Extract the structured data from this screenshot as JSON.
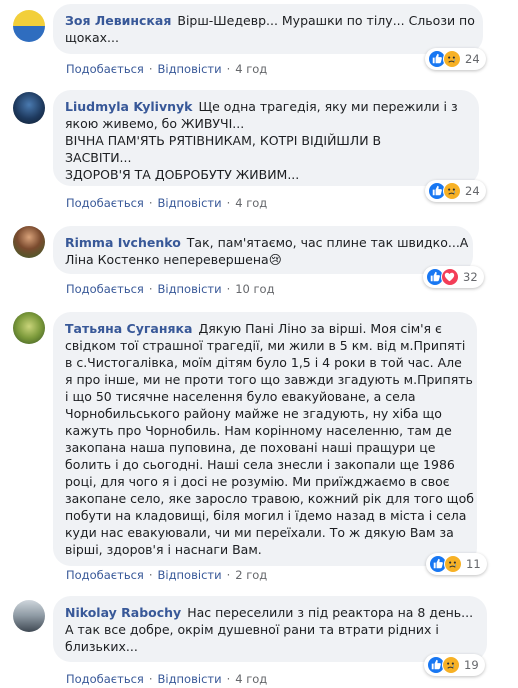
{
  "comments": [
    {
      "author": "Зоя Левинская",
      "lines": [
        "Вірш-Шедевр... Мурашки по тілу... Сльози по",
        "щоках..."
      ],
      "actions": {
        "like": "Подобається",
        "reply": "Відповісти",
        "time": "4 год"
      },
      "reactions": {
        "icons": [
          "like-icon",
          "sad-icon"
        ],
        "count": "24"
      }
    },
    {
      "author": "Liudmyla Kylivnyk",
      "lines": [
        "Ще одна трагедія, яку ми пережили і з",
        "якою живемо, бо ЖИВУЧІ...",
        "ВІЧНА ПАМ'ЯТЬ РЯТІВНИКАМ, КОТРІ ВІДІЙШЛИ В",
        "ЗАСВІТИ...",
        "ЗДОРОВ'Я ТА ДОБРОБУТУ ЖИВИМ..."
      ],
      "actions": {
        "like": "Подобається",
        "reply": "Відповісти",
        "time": "4 год"
      },
      "reactions": {
        "icons": [
          "like-icon",
          "sad-icon"
        ],
        "count": "24"
      }
    },
    {
      "author": "Rimma Ivchenko",
      "lines": [
        "Так, пам'ятаємо, час плине так швидко...А",
        "Ліна Костенко неперевершена😢"
      ],
      "actions": {
        "like": "Подобається",
        "reply": "Відповісти",
        "time": "10 год"
      },
      "reactions": {
        "icons": [
          "like-icon",
          "love-icon"
        ],
        "count": "32"
      }
    },
    {
      "author": "Татьяна Суганяка",
      "lines": [
        "Дякую Пані Ліно за вірші. Моя сім'я є",
        "свідком тої страшної трагедії, ми жили в 5 км. від м.Припяті",
        "в с.Чистогалівка, моїм дітям було 1,5 і 4 роки в той час. Але",
        "я про інше, ми не проти того що завжди згадують м.Припять",
        "і що 50 тисячне населення було евакуйоване, а села",
        "Чорнобильського району майже не згадують, ну хіба що",
        "кажуть про Чорнобиль. Нам корінному населенню, там де",
        "закопана наша пуповина, де поховані наші пращури це",
        "болить і до сьогодні. Наші села знесли і закопали ще 1986",
        "році, для чого я і досі не розумію. Ми приїжджаємо в своє",
        "закопане село, яке заросло травою, кожний рік для того щоб",
        "побути на кладовищі, біля могил і їдемо назад в міста і села",
        "куди нас евакуювали, чи ми переїхали. То ж дякую Вам за",
        "вірші, здоров'я і наснаги Вам."
      ],
      "actions": {
        "like": "Подобається",
        "reply": "Відповісти",
        "time": "2 год"
      },
      "reactions": {
        "icons": [
          "like-icon",
          "sad-icon"
        ],
        "count": "11"
      }
    },
    {
      "author": "Nikolay Rabochy",
      "lines": [
        "Нас переселили з під реактора на 8 день...",
        "А так все добре, окрім душевної рани та втрати рідних і",
        "близьких..."
      ],
      "actions": {
        "like": "Подобається",
        "reply": "Відповісти",
        "time": "4 год"
      },
      "reactions": {
        "icons": [
          "like-icon",
          "sad-icon"
        ],
        "count": "19"
      }
    }
  ],
  "colors": {
    "author": "#385898",
    "bubble": "#f0f2f5",
    "meta": "#65676b",
    "like": "#1877f2",
    "sad": "#f7b125",
    "love": "#f33e58"
  }
}
